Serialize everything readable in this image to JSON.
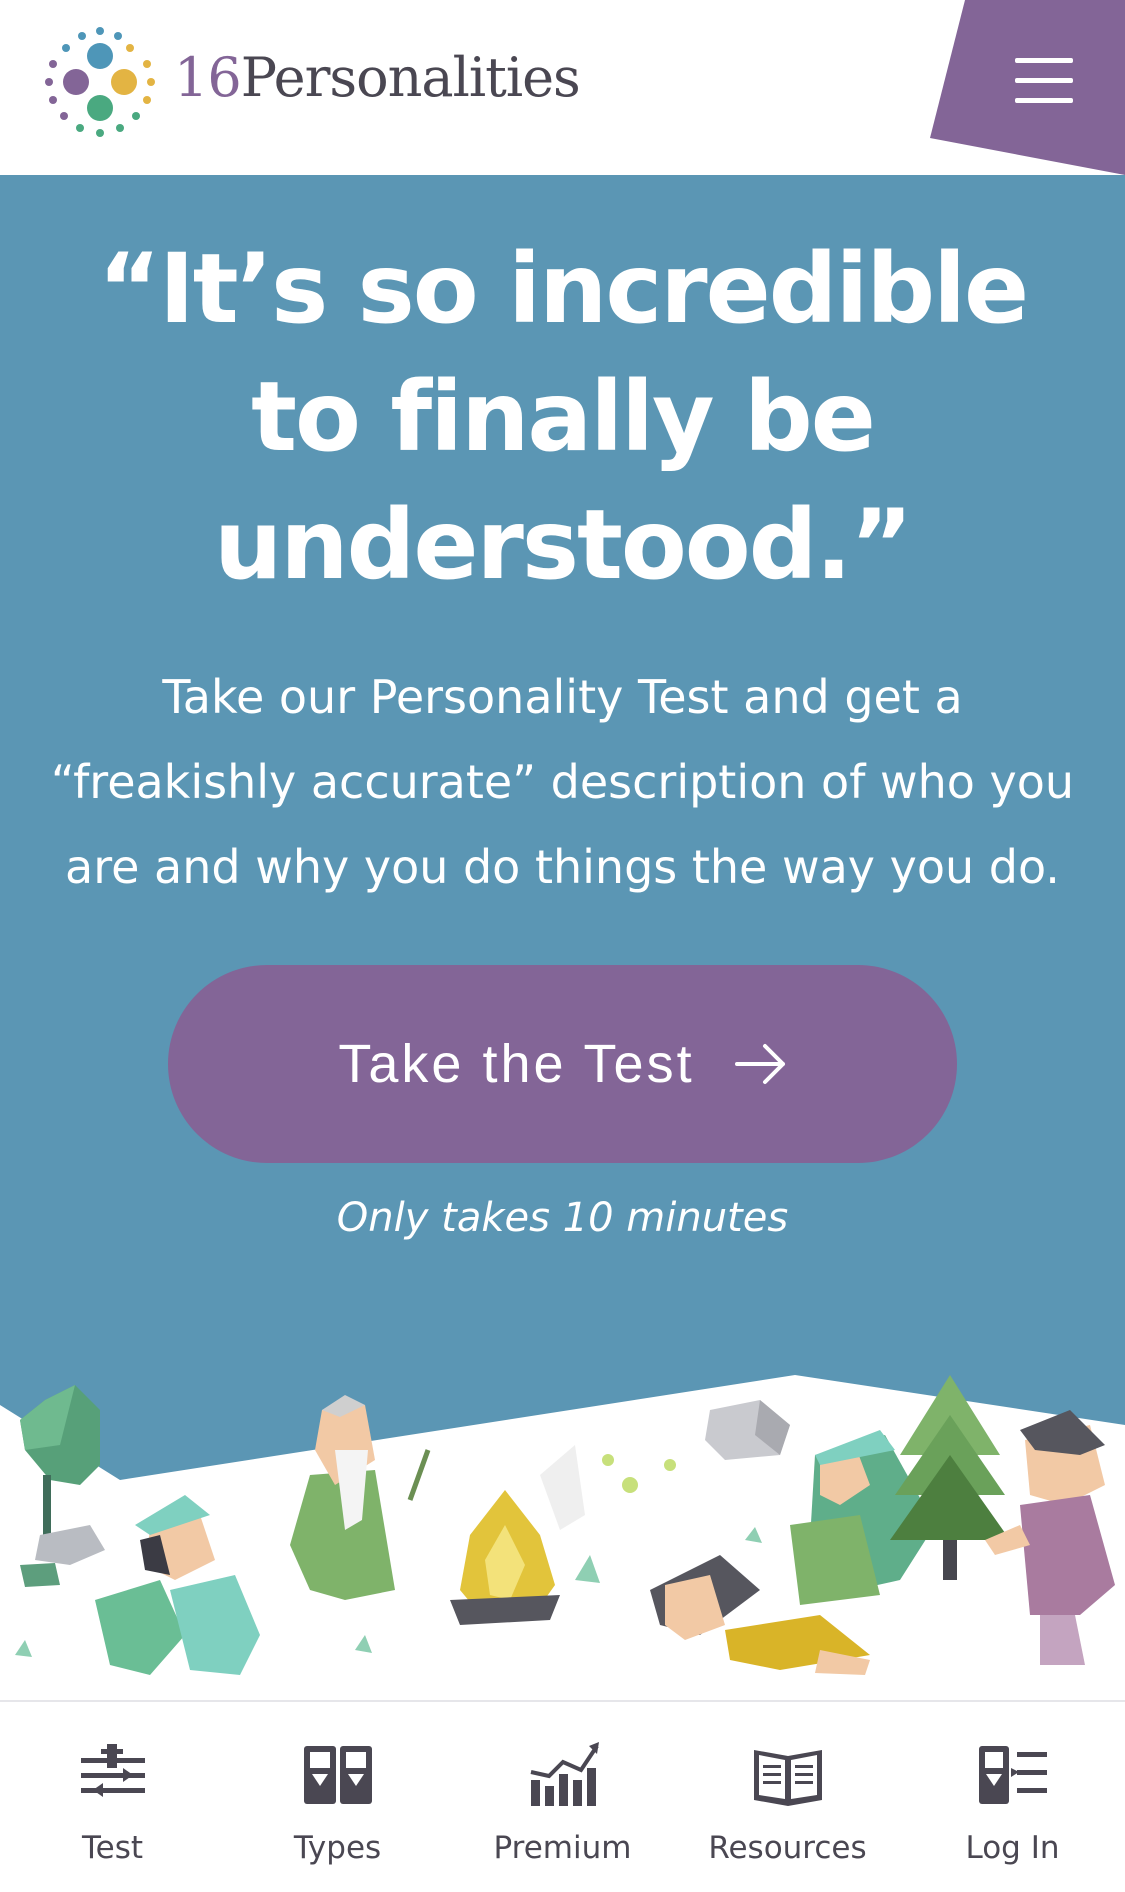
{
  "header": {
    "brand_number": "16",
    "brand_name": "Personalities",
    "logo_icon": "dotted-circle-logo-icon",
    "menu_icon": "hamburger-menu-icon",
    "accent": "#836597"
  },
  "hero": {
    "headline": "“It’s so incredible to finally be understood.”",
    "subtext": "Take our Personality Test and get a “freakishly accurate” description of who you are and why you do things the way you do.",
    "cta_label": "Take the Test",
    "cta_icon": "arrow-right-icon",
    "note": "Only takes 10 minutes",
    "background": "#5b96b4",
    "illustration_icon": "campfire-characters-illustration"
  },
  "bottom_nav": {
    "items": [
      {
        "label": "Test",
        "icon": "sliders-icon"
      },
      {
        "label": "Types",
        "icon": "people-cards-icon"
      },
      {
        "label": "Premium",
        "icon": "bar-chart-growth-icon"
      },
      {
        "label": "Resources",
        "icon": "open-book-icon"
      },
      {
        "label": "Log In",
        "icon": "user-list-icon"
      }
    ]
  }
}
